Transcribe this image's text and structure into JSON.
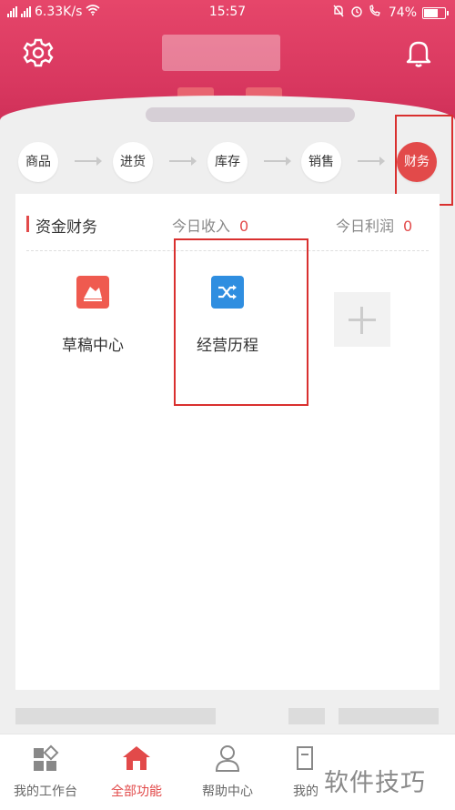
{
  "status_bar": {
    "signal_left": "ℴall",
    "net_speed": "6.33K/s",
    "time": "15:57",
    "battery_pct": "74%",
    "battery_level": 0.74
  },
  "flow_steps": [
    "商品",
    "进货",
    "库存",
    "销售",
    "财务"
  ],
  "active_step": "财务",
  "card": {
    "title": "资金财务",
    "today_income_label": "今日收入",
    "today_income_value": "0",
    "today_profit_label": "今日利润",
    "today_profit_value": "0"
  },
  "tiles": [
    {
      "label": "草稿中心",
      "icon": "draft-icon",
      "color": "#ef5a4f"
    },
    {
      "label": "经营历程",
      "icon": "shuffle-icon",
      "color": "#2f8ee0"
    }
  ],
  "tabs": [
    {
      "label": "我的工作台",
      "icon": "workbench-icon"
    },
    {
      "label": "全部功能",
      "icon": "home-icon"
    },
    {
      "label": "帮助中心",
      "icon": "person-icon"
    },
    {
      "label": "我的",
      "icon": "profile-icon"
    }
  ],
  "watermark": "软件技巧",
  "colors": {
    "brand": "#e24a4a",
    "header": "#d8375f",
    "highlight": "#d9302f"
  }
}
